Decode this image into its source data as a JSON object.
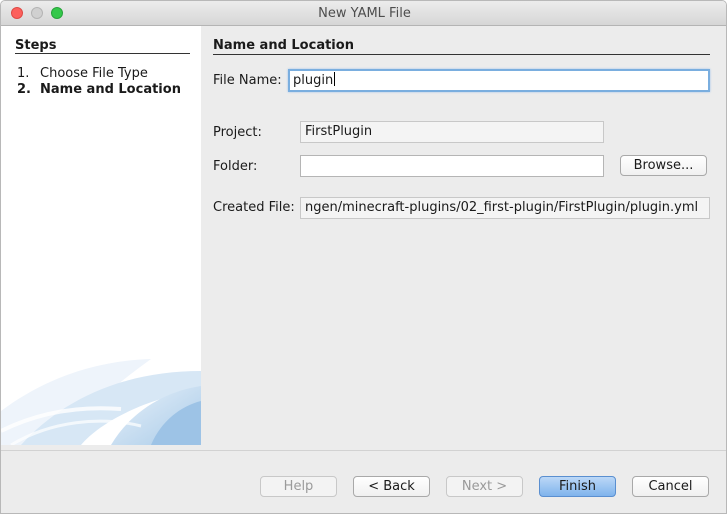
{
  "window": {
    "title": "New YAML File"
  },
  "steps": {
    "title": "Steps",
    "items": [
      {
        "number": "1.",
        "label": "Choose File Type"
      },
      {
        "number": "2.",
        "label": "Name and Location"
      }
    ]
  },
  "main": {
    "section_title": "Name and Location",
    "file_name": {
      "label": "File Name:",
      "value": "plugin"
    },
    "project": {
      "label": "Project:",
      "value": "FirstPlugin"
    },
    "folder": {
      "label": "Folder:",
      "value": ""
    },
    "browse_label": "Browse...",
    "created_file": {
      "label": "Created File:",
      "value": "ngen/minecraft-plugins/02_first-plugin/FirstPlugin/plugin.yml"
    }
  },
  "footer": {
    "help_label": "Help",
    "back_label": "< Back",
    "next_label": "Next >",
    "finish_label": "Finish",
    "cancel_label": "Cancel"
  },
  "colors": {
    "close": "#fc605c",
    "minimize": "#d0d0d0",
    "maximize": "#34c84a",
    "focus_ring": "#7aaedf",
    "default_button": "#7fb3ec"
  }
}
